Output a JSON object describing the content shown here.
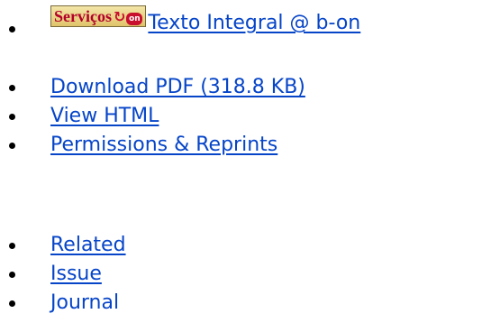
{
  "fulltext": {
    "badge": {
      "label": "Serviços",
      "mark": "on"
    },
    "link": "Texto Integral @ b-on"
  },
  "actions": [
    {
      "label": "Download PDF (318.8 KB)"
    },
    {
      "label": "View HTML"
    },
    {
      "label": "Permissions & Reprints"
    }
  ],
  "nav": [
    {
      "label": "Related"
    },
    {
      "label": "Issue"
    },
    {
      "label": "Journal"
    }
  ],
  "colors": {
    "link": "#0645c8",
    "bullet": "#000000",
    "badge_text": "#b3002a",
    "badge_bg": "#e0c46a"
  }
}
